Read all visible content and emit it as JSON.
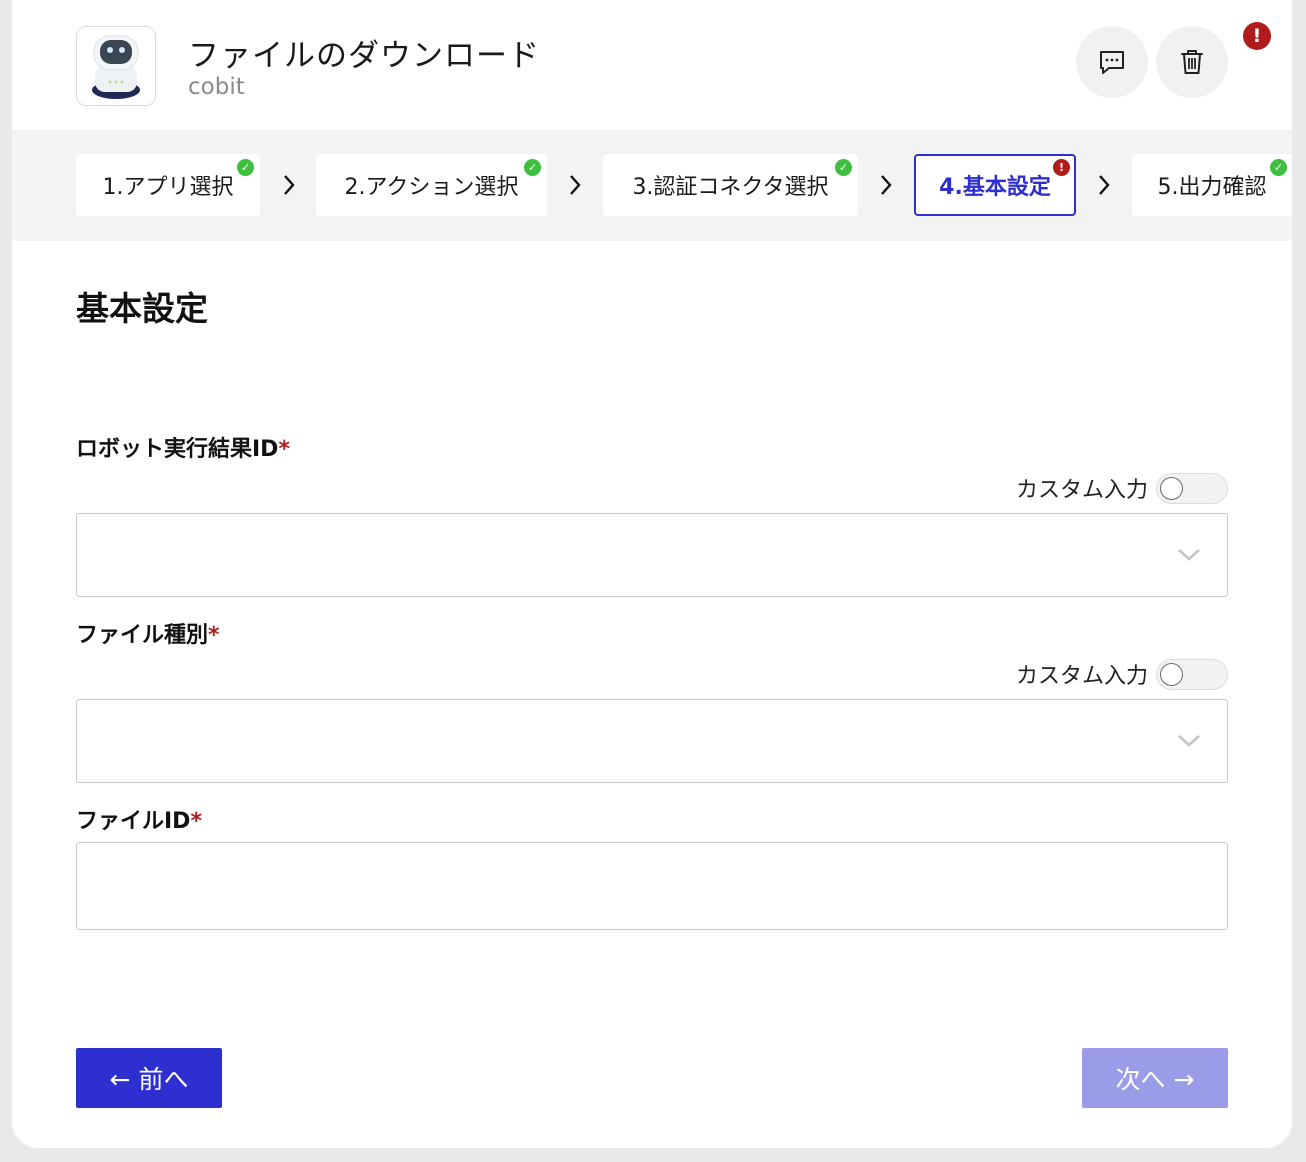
{
  "header": {
    "title": "ファイルのダウンロード",
    "subtitle": "cobit",
    "app_icon": "robot-icon",
    "comment_icon": "comment-icon",
    "delete_icon": "trash-icon",
    "error_badge": "!"
  },
  "stepper": {
    "steps": [
      {
        "label": "1.アプリ選択",
        "status": "ok"
      },
      {
        "label": "2.アクション選択",
        "status": "ok"
      },
      {
        "label": "3.認証コネクタ選択",
        "status": "ok"
      },
      {
        "label": "4.基本設定",
        "status": "error",
        "active": true
      },
      {
        "label": "5.出力確認",
        "status": "ok"
      }
    ],
    "badge_ok": "✓",
    "badge_error": "!"
  },
  "form": {
    "section_title": "基本設定",
    "required_mark": "*",
    "fields": [
      {
        "label": "ロボット実行結果ID",
        "type": "select",
        "custom_label": "カスタム入力",
        "custom_enabled": false,
        "value": ""
      },
      {
        "label": "ファイル種別",
        "type": "select",
        "custom_label": "カスタム入力",
        "custom_enabled": false,
        "value": ""
      },
      {
        "label": "ファイルID",
        "type": "text",
        "value": ""
      }
    ]
  },
  "footer": {
    "prev_label": "← 前へ",
    "next_label": "次へ →"
  },
  "colors": {
    "accent": "#2e2fd0",
    "accent_disabled": "#9b9ce8",
    "error": "#b01c1c",
    "success": "#3fbf3f"
  }
}
